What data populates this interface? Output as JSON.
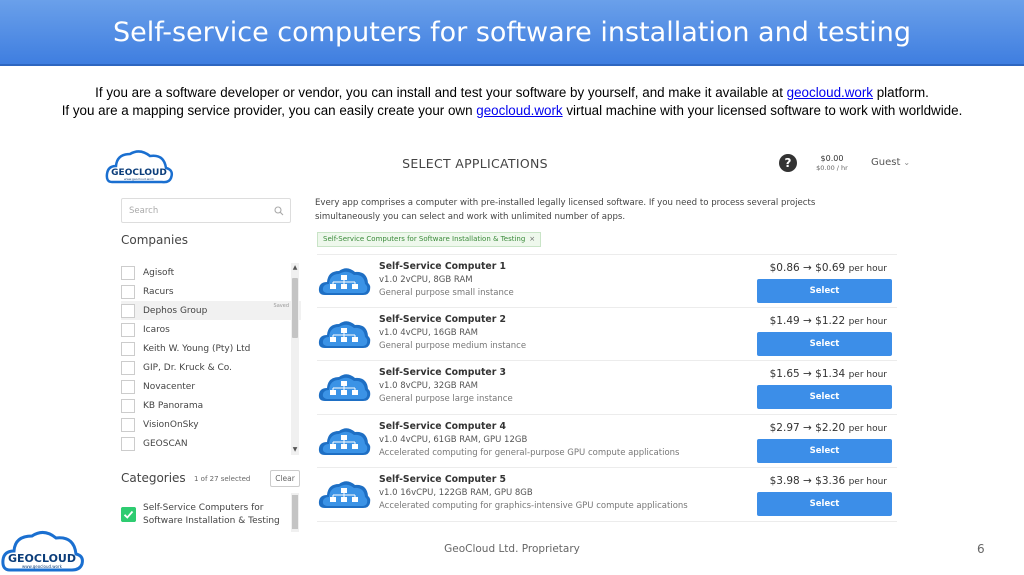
{
  "slide": {
    "title": "Self-service computers for software installation and testing",
    "intro_line1_prefix": "If you are a software developer or vendor, you can install and test your software by yourself, and make it available at ",
    "intro_line1_link": "geocloud.work",
    "intro_line1_suffix": " platform.",
    "intro_line2_prefix": "If you are a mapping service provider, you can easily create your own ",
    "intro_line2_link": "geocloud.work",
    "intro_line2_suffix": " virtual machine with your licensed software to work with worldwide.",
    "footer": "GeoCloud Ltd. Proprietary",
    "page_number": "6"
  },
  "logo": {
    "name": "GEOCLOUD",
    "tagline": "www.geocloud.work"
  },
  "app": {
    "title": "SELECT APPLICATIONS",
    "help_icon": "question-circle-icon",
    "balance": "$0.00",
    "rate": "$0.00 / hr",
    "user": "Guest",
    "search_placeholder": "Search",
    "companies_title": "Companies",
    "companies": [
      {
        "label": "Agisoft"
      },
      {
        "label": "Racurs"
      },
      {
        "label": "Dephos Group",
        "tag": "Saved"
      },
      {
        "label": "Icaros"
      },
      {
        "label": "Keith W. Young (Pty) Ltd"
      },
      {
        "label": "GIP, Dr. Kruck & Co."
      },
      {
        "label": "Novacenter"
      },
      {
        "label": "KB Panorama"
      },
      {
        "label": "VisionOnSky"
      },
      {
        "label": "GEOSCAN"
      }
    ],
    "categories_title": "Categories",
    "categories_count": "1 of 27 selected",
    "clear_label": "Clear",
    "category_selected": "Self-Service Computers for Software Installation & Testing",
    "intro_text": "Every app comprises a computer with pre-installed legally licensed software. If you need to process several projects simultaneously you can select and work with unlimited number of apps.",
    "filter_chip": "Self-Service Computers for Software Installation & Testing",
    "filter_chip_close": "×",
    "select_label": "Select",
    "per_hour": "per hour",
    "products": [
      {
        "name": "Self-Service Computer 1",
        "specs": "v1.0   2vCPU, 8GB RAM",
        "desc": "General purpose small instance",
        "price": "$0.86 → $0.69"
      },
      {
        "name": "Self-Service Computer 2",
        "specs": "v1.0   4vCPU, 16GB RAM",
        "desc": "General purpose medium instance",
        "price": "$1.49 → $1.22"
      },
      {
        "name": "Self-Service Computer 3",
        "specs": "v1.0   8vCPU, 32GB RAM",
        "desc": "General purpose large instance",
        "price": "$1.65 → $1.34"
      },
      {
        "name": "Self-Service Computer 4",
        "specs": "v1.0   4vCPU, 61GB RAM, GPU 12GB",
        "desc": "Accelerated computing for general-purpose GPU compute applications",
        "price": "$2.97 → $2.20"
      },
      {
        "name": "Self-Service Computer 5",
        "specs": "v1.0   16vCPU, 122GB RAM, GPU 8GB",
        "desc": "Accelerated computing for graphics-intensive GPU compute applications",
        "price": "$3.98 → $3.36"
      }
    ]
  },
  "colors": {
    "header": "#3f7ee0",
    "accent": "#3c8ee8",
    "check": "#2ecc71",
    "logo": "#1a6fd0"
  }
}
